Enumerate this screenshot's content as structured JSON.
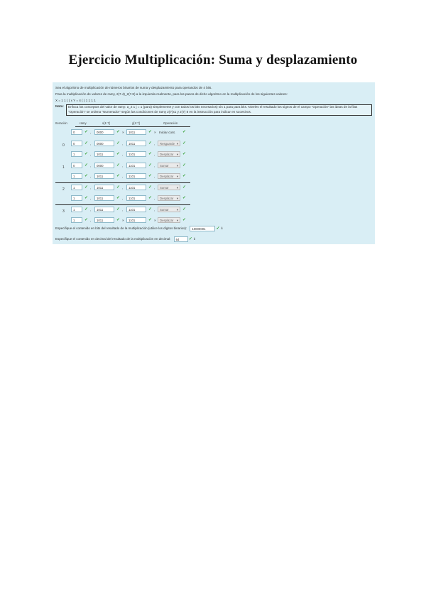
{
  "title": "Ejercicio Multiplicación: Suma y desplazamiento",
  "intro": {
    "line1": "Sea el algoritmo de multiplicación de números binarios de suma y desplazamiento para operandos de 4 bits.",
    "line2": "Para la multiplicación de valores de ramy, 2(7.4)_2(7.8) a la izquierda realmente, para los pasos de dicho algoritmo en la multiplicación de los siguientes valores:",
    "line3": "X = 1 1 ( ) x Y = 4 ( ) 1 1 1 1"
  },
  "note": {
    "label": "Nota:",
    "text": "Enfoca los conceptos del valor de ramy: a_2 1 j = 1 (para) simplemente y con todos los bits necesarios) sin 1 para para bits. Niveles el resultado los signos de el campo \"Operación\" las ideas de la filas \"Operación\" se ordena \"Numerador\" según las condiciones de ramy 2(7)x1 y 2(7) 8 en la instrucción para indicar en sucesivos."
  },
  "headers": {
    "iter": "Iteración",
    "c": "ramy",
    "x": "x[1:7]",
    "y": "y[1:7]",
    "op": "Operación"
  },
  "rows": [
    {
      "iter": "",
      "c": "0",
      "x": "0000",
      "y": "1011",
      "op": "Iniciar cont.",
      "opSel": false,
      "mul": true
    },
    {
      "iter": "0",
      "c": "0",
      "x": "0000",
      "y": "1011",
      "op": "Resguarde",
      "opSel": true,
      "mul": false
    },
    {
      "iter": "",
      "c": "1",
      "x": "1011",
      "y": "1101",
      "op": "Desplazar",
      "opSel": true,
      "mul": false
    },
    {
      "iter": "1",
      "c": "0",
      "x": "0000",
      "y": "1101",
      "op": "Sumar",
      "opSel": true,
      "mul": false
    },
    {
      "iter": "",
      "c": "1",
      "x": "1011",
      "y": "1101",
      "op": "Desplazar",
      "opSel": true,
      "mul": false
    },
    {
      "iter": "2",
      "c": "1",
      "x": "1011",
      "y": "1101",
      "op": "Sumar",
      "opSel": true,
      "mul": false
    },
    {
      "iter": "",
      "c": "1",
      "x": "1011",
      "y": "1101",
      "op": "Desplazar",
      "opSel": true,
      "mul": false
    },
    {
      "iter": "3",
      "c": "1",
      "x": "1011",
      "y": "1101",
      "op": "Sumar",
      "opSel": true,
      "mul": false
    },
    {
      "iter": "",
      "c": "1",
      "x": "1011",
      "y": "1101",
      "op": "Desplazar",
      "opSel": true,
      "mul": true
    }
  ],
  "summary": {
    "q1": "Especifique el contenido en bits del resultado de la multiplicación (utilice los dígitos binarios):",
    "a1": "10000001",
    "q2": "Especifique el contenido en decimal del resultado de la multiplicación en decimal:",
    "a2": "64"
  },
  "colors": {
    "panel": "#d9eef5",
    "check": "#3aa33a"
  }
}
